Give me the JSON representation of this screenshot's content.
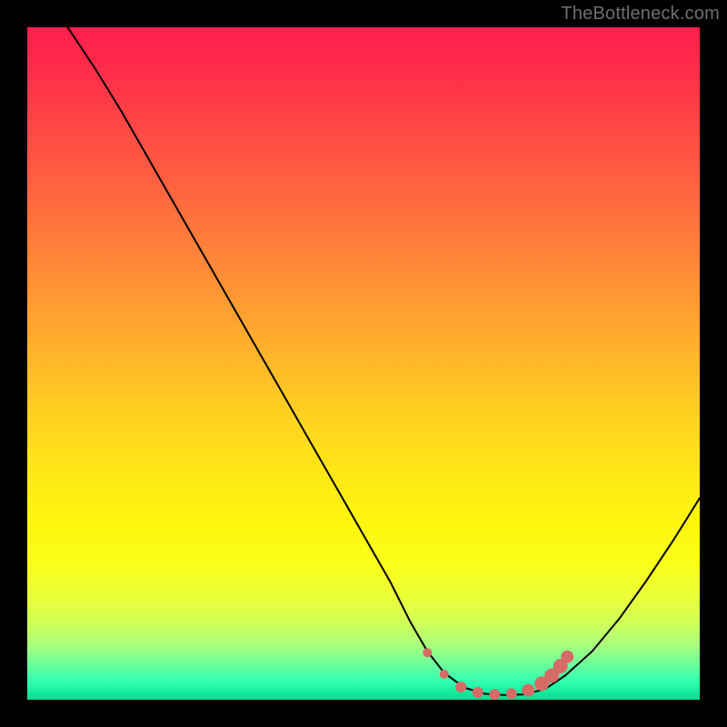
{
  "watermark": "TheBottleneck.com",
  "colors": {
    "frame": "#000000",
    "curve": "#000000",
    "marker_fill": "#d66b66",
    "marker_stroke": "#c85a55",
    "gradient_top": "#ff1f4b",
    "gradient_bottom": "#10d890"
  },
  "chart_data": {
    "type": "line",
    "title": "",
    "xlabel": "",
    "ylabel": "",
    "xlim": [
      0,
      100
    ],
    "ylim": [
      0,
      100
    ],
    "grid": false,
    "legend": false,
    "description": "Single V-shaped bottleneck curve on a vertical rainbow gradient (red at top = high bottleneck, green at bottom = low). Minimum region highlighted with salmon markers.",
    "series": [
      {
        "name": "bottleneck-curve",
        "x": [
          6,
          10,
          14,
          18,
          22,
          26,
          30,
          34,
          38,
          42,
          46,
          50,
          54,
          57,
          59.5,
          62,
          65,
          68,
          71,
          74,
          77,
          80,
          84,
          88,
          92,
          96,
          100
        ],
        "y": [
          100,
          94,
          87.5,
          80.5,
          73.5,
          66.5,
          59.5,
          52.5,
          45.5,
          38.5,
          31.5,
          24.5,
          17.5,
          11.5,
          7.2,
          4.0,
          1.8,
          0.9,
          0.7,
          0.8,
          1.6,
          3.6,
          7.2,
          12.0,
          17.6,
          23.6,
          30.0
        ]
      }
    ],
    "optimum_markers": {
      "name": "optimum-range",
      "points": [
        {
          "x": 59.5,
          "y": 7.0,
          "r": 5
        },
        {
          "x": 62.0,
          "y": 3.8,
          "r": 5
        },
        {
          "x": 64.5,
          "y": 1.9,
          "r": 6
        },
        {
          "x": 67.0,
          "y": 1.1,
          "r": 6
        },
        {
          "x": 69.5,
          "y": 0.8,
          "r": 6
        },
        {
          "x": 72.0,
          "y": 0.9,
          "r": 6
        },
        {
          "x": 74.5,
          "y": 1.4,
          "r": 7
        },
        {
          "x": 76.5,
          "y": 2.4,
          "r": 8
        },
        {
          "x": 78.0,
          "y": 3.6,
          "r": 8
        },
        {
          "x": 79.3,
          "y": 5.0,
          "r": 8
        },
        {
          "x": 80.3,
          "y": 6.4,
          "r": 7
        }
      ]
    }
  }
}
